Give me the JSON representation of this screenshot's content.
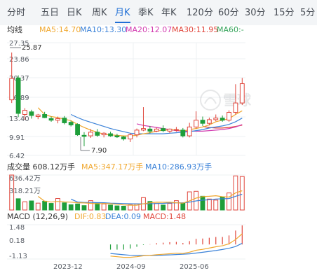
{
  "tabs": [
    {
      "label": "分时",
      "active": false
    },
    {
      "label": "五日",
      "active": false
    },
    {
      "label": "日K",
      "active": false
    },
    {
      "label": "周K",
      "active": false
    },
    {
      "label": "月K",
      "active": true
    },
    {
      "label": "季K",
      "active": false
    },
    {
      "label": "年K",
      "active": false
    },
    {
      "label": "120分",
      "active": false
    },
    {
      "label": "60分",
      "active": false
    },
    {
      "label": "30分",
      "active": false
    },
    {
      "label": "15分",
      "active": false
    },
    {
      "label": "5分",
      "active": false
    }
  ],
  "colors": {
    "up": "#e0453b",
    "down": "#1e9e3a",
    "ma5": "#f0a830",
    "ma10": "#3b82d8",
    "ma20": "#d23bb0",
    "ma30": "#e0453b",
    "ma60": "#35a45a",
    "dif": "#f0a830",
    "dea": "#3b82d8",
    "macd_pos": "#e0453b",
    "macd_neg": "#1e9e3a",
    "accent": "#1f6fd6",
    "axis_text": "#5a5f67",
    "grid": "#eef0f3"
  },
  "price_panel": {
    "ma_legend": {
      "label": "均线",
      "items": [
        {
          "text": "MA5:14.70",
          "color_key": "ma5"
        },
        {
          "text": "MA10:13.30",
          "color_key": "ma10"
        },
        {
          "text": "MA20:12.07",
          "color_key": "ma20"
        },
        {
          "text": "MA30:11.95",
          "color_key": "ma30"
        },
        {
          "text": "MA60:-",
          "color_key": "ma60"
        }
      ]
    },
    "y_ticks": [
      "27.35",
      "23.86",
      "20.37",
      "16.89",
      "13.40",
      "9.91",
      "6.42"
    ],
    "high_marker": "25.87",
    "low_marker": "7.90",
    "watermark": "雪球"
  },
  "volume_panel": {
    "legend": {
      "label": "成交量 608.12万手",
      "items": [
        {
          "text": "MA5:347.17万手",
          "color_key": "ma5"
        },
        {
          "text": "MA10:286.93万手",
          "color_key": "ma10"
        }
      ]
    },
    "y_ticks": [
      "636.42万",
      "318.21万"
    ]
  },
  "macd_panel": {
    "legend": {
      "label": "MACD (12,26,9)",
      "items": [
        {
          "text": "DIF:0.83",
          "color_key": "dif"
        },
        {
          "text": "DEA:0.09",
          "color_key": "dea"
        },
        {
          "text": "MACD:1.48",
          "color_key": "macd_pos"
        }
      ]
    },
    "y_ticks": [
      "1.48",
      "0.18",
      "-1.13"
    ]
  },
  "x_axis_labels": [
    "2023-12",
    "2024-09",
    "2025-06"
  ],
  "chart_data": {
    "type": "candlestick",
    "period": "monthly",
    "price_range": [
      6.42,
      27.35
    ],
    "candles": [
      {
        "o": 16.8,
        "h": 25.87,
        "l": 16.2,
        "c": 20.9
      },
      {
        "o": 21.0,
        "h": 21.5,
        "l": 13.5,
        "c": 14.2
      },
      {
        "o": 14.0,
        "h": 15.2,
        "l": 13.0,
        "c": 14.8
      },
      {
        "o": 14.5,
        "h": 14.9,
        "l": 13.2,
        "c": 13.8
      },
      {
        "o": 13.6,
        "h": 14.1,
        "l": 13.1,
        "c": 13.9
      },
      {
        "o": 14.0,
        "h": 14.5,
        "l": 13.3,
        "c": 13.4
      },
      {
        "o": 13.2,
        "h": 13.6,
        "l": 12.6,
        "c": 12.9
      },
      {
        "o": 12.9,
        "h": 13.6,
        "l": 12.3,
        "c": 13.2
      },
      {
        "o": 13.3,
        "h": 13.7,
        "l": 12.1,
        "c": 12.4
      },
      {
        "o": 12.5,
        "h": 12.8,
        "l": 11.7,
        "c": 12.0
      },
      {
        "o": 12.1,
        "h": 12.3,
        "l": 9.9,
        "c": 10.1
      },
      {
        "o": 10.0,
        "h": 10.6,
        "l": 7.9,
        "c": 9.8
      },
      {
        "o": 9.9,
        "h": 11.2,
        "l": 9.5,
        "c": 10.6
      },
      {
        "o": 10.6,
        "h": 11.2,
        "l": 9.7,
        "c": 10.0
      },
      {
        "o": 10.1,
        "h": 10.6,
        "l": 9.6,
        "c": 10.4
      },
      {
        "o": 10.3,
        "h": 10.7,
        "l": 9.7,
        "c": 9.9
      },
      {
        "o": 9.9,
        "h": 10.3,
        "l": 9.5,
        "c": 9.7
      },
      {
        "o": 9.7,
        "h": 9.9,
        "l": 9.0,
        "c": 9.3
      },
      {
        "o": 9.3,
        "h": 10.4,
        "l": 8.7,
        "c": 10.1
      },
      {
        "o": 10.1,
        "h": 11.3,
        "l": 9.6,
        "c": 11.0
      },
      {
        "o": 11.0,
        "h": 15.4,
        "l": 10.8,
        "c": 11.3
      },
      {
        "o": 11.2,
        "h": 11.8,
        "l": 10.4,
        "c": 10.8
      },
      {
        "o": 10.8,
        "h": 11.5,
        "l": 10.6,
        "c": 11.2
      },
      {
        "o": 11.3,
        "h": 11.9,
        "l": 10.6,
        "c": 10.9
      },
      {
        "o": 10.8,
        "h": 11.3,
        "l": 10.4,
        "c": 11.2
      },
      {
        "o": 11.1,
        "h": 11.6,
        "l": 10.7,
        "c": 11.1
      },
      {
        "o": 11.0,
        "h": 11.4,
        "l": 9.6,
        "c": 9.9
      },
      {
        "o": 9.9,
        "h": 12.4,
        "l": 9.6,
        "c": 11.6
      },
      {
        "o": 11.6,
        "h": 14.6,
        "l": 11.3,
        "c": 12.9
      },
      {
        "o": 12.9,
        "h": 13.6,
        "l": 11.8,
        "c": 12.3
      },
      {
        "o": 12.3,
        "h": 13.4,
        "l": 11.9,
        "c": 13.0
      },
      {
        "o": 13.0,
        "h": 14.0,
        "l": 12.7,
        "c": 13.3
      },
      {
        "o": 13.3,
        "h": 13.8,
        "l": 12.6,
        "c": 12.9
      },
      {
        "o": 12.9,
        "h": 14.8,
        "l": 12.6,
        "c": 14.4
      },
      {
        "o": 14.4,
        "h": 19.8,
        "l": 14.0,
        "c": 16.2
      },
      {
        "o": 16.2,
        "h": 21.0,
        "l": 15.8,
        "c": 19.9
      }
    ],
    "ma_lines": {
      "ma5": [
        null,
        null,
        null,
        null,
        15.3,
        14.0,
        13.6,
        13.4,
        13.1,
        12.8,
        12.1,
        11.5,
        11.0,
        10.6,
        10.2,
        10.1,
        10.0,
        9.9,
        9.9,
        10.0,
        10.3,
        10.5,
        10.8,
        11.0,
        11.0,
        11.1,
        10.8,
        11.1,
        11.3,
        11.6,
        12.0,
        12.6,
        12.9,
        13.2,
        14.0,
        14.7
      ],
      "ma10": [
        null,
        null,
        null,
        null,
        null,
        null,
        null,
        null,
        null,
        14.0,
        13.4,
        12.9,
        12.5,
        12.1,
        11.7,
        11.3,
        11.0,
        10.7,
        10.4,
        10.3,
        10.3,
        10.3,
        10.3,
        10.3,
        10.4,
        10.5,
        10.6,
        10.7,
        10.9,
        11.1,
        11.4,
        11.6,
        11.8,
        12.1,
        12.6,
        13.3
      ],
      "ma20": [
        null,
        null,
        null,
        null,
        null,
        null,
        null,
        null,
        null,
        null,
        null,
        null,
        null,
        null,
        null,
        null,
        null,
        null,
        null,
        12.2,
        11.9,
        11.7,
        11.5,
        11.3,
        11.1,
        10.9,
        10.8,
        10.8,
        10.8,
        10.8,
        10.9,
        11.0,
        11.1,
        11.3,
        11.6,
        12.07
      ],
      "ma30": [
        null,
        null,
        null,
        null,
        null,
        null,
        null,
        null,
        null,
        null,
        null,
        null,
        null,
        null,
        null,
        null,
        null,
        null,
        null,
        null,
        null,
        null,
        null,
        null,
        null,
        null,
        null,
        null,
        null,
        11.7,
        11.5,
        11.4,
        11.4,
        11.5,
        11.7,
        11.95
      ]
    },
    "volume_range": [
      0,
      636.42
    ],
    "volume": [
      636.42,
      205,
      150,
      165,
      125,
      160,
      120,
      210,
      130,
      95,
      110,
      80,
      170,
      120,
      110,
      90,
      75,
      70,
      95,
      110,
      225,
      155,
      120,
      90,
      120,
      170,
      125,
      330,
      340,
      250,
      200,
      180,
      240,
      310,
      620,
      608.12
    ],
    "vol_ma5": [
      null,
      null,
      null,
      null,
      248,
      161,
      144,
      156,
      147,
      143,
      133,
      129,
      121,
      115,
      118,
      114,
      105,
      93,
      88,
      88,
      113,
      131,
      141,
      140,
      142,
      131,
      125,
      167,
      217,
      243,
      249,
      260,
      242,
      236,
      310,
      350
    ],
    "vol_ma10": [
      null,
      null,
      null,
      null,
      null,
      null,
      null,
      null,
      null,
      198,
      145,
      137,
      138,
      134,
      133,
      125,
      121,
      119,
      114,
      112,
      112,
      113,
      118,
      121,
      128,
      130,
      131,
      143,
      166,
      179,
      186,
      199,
      204,
      209,
      250,
      287
    ],
    "macd_range": [
      -1.13,
      1.48
    ],
    "dif": [
      null,
      null,
      null,
      null,
      null,
      null,
      null,
      null,
      null,
      null,
      null,
      null,
      null,
      null,
      null,
      -0.9,
      -0.95,
      -1.0,
      -1.0,
      -0.95,
      -0.88,
      -0.85,
      -0.8,
      -0.76,
      -0.72,
      -0.68,
      -0.7,
      -0.6,
      -0.45,
      -0.38,
      -0.28,
      -0.18,
      -0.1,
      0.05,
      0.38,
      0.83
    ],
    "dea": [
      null,
      null,
      null,
      null,
      null,
      null,
      null,
      null,
      null,
      null,
      null,
      null,
      null,
      null,
      null,
      -0.7,
      -0.75,
      -0.8,
      -0.84,
      -0.86,
      -0.86,
      -0.86,
      -0.85,
      -0.83,
      -0.81,
      -0.78,
      -0.76,
      -0.73,
      -0.67,
      -0.61,
      -0.54,
      -0.47,
      -0.39,
      -0.3,
      -0.16,
      0.09
    ],
    "macd": [
      null,
      null,
      null,
      null,
      null,
      null,
      null,
      null,
      null,
      null,
      null,
      null,
      null,
      null,
      null,
      -0.4,
      -0.4,
      -0.4,
      -0.32,
      -0.18,
      -0.04,
      0.02,
      0.1,
      0.14,
      0.18,
      0.2,
      0.12,
      0.26,
      0.44,
      0.46,
      0.52,
      0.58,
      0.58,
      0.7,
      1.08,
      1.48
    ]
  }
}
